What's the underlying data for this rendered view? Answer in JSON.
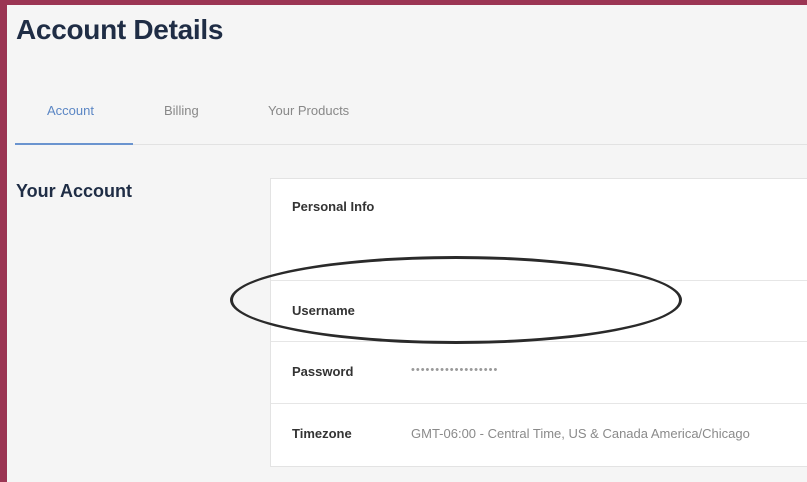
{
  "header": {
    "title": "Account Details"
  },
  "tabs": [
    {
      "label": "Account"
    },
    {
      "label": "Billing"
    },
    {
      "label": "Your Products"
    }
  ],
  "section": {
    "title": "Your Account"
  },
  "account": {
    "personal_info": {
      "label": "Personal Info"
    },
    "username": {
      "label": "Username",
      "value": ""
    },
    "password": {
      "label": "Password",
      "value": "••••••••••••••••••"
    },
    "timezone": {
      "label": "Timezone",
      "value": "GMT-06:00 - Central Time, US & Canada America/Chicago"
    }
  },
  "colors": {
    "frame": "#9b3553",
    "active_tab": "#5b86c4",
    "heading": "#1f2d45"
  }
}
